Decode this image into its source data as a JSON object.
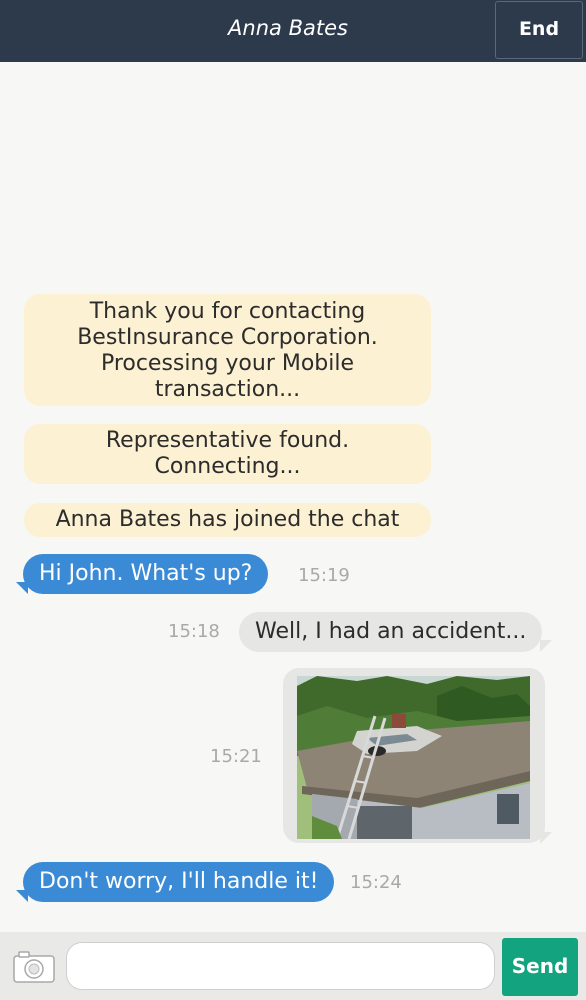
{
  "header": {
    "title": "Anna Bates",
    "end_label": "End"
  },
  "system_messages": [
    "Thank you for contacting BestInsurance Corporation. Processing your Mobile transaction...",
    "Representative found. Connecting...",
    "Anna Bates has joined the chat"
  ],
  "messages": [
    {
      "sender": "agent",
      "text": "Hi John. What's up?",
      "time": "15:19"
    },
    {
      "sender": "user",
      "text": "Well, I had an accident...",
      "time": "15:18"
    },
    {
      "sender": "user",
      "type": "image",
      "image_description": "photo of a car crashed onto a house roof with a ladder",
      "time": "15:21"
    },
    {
      "sender": "agent",
      "text": "Don't worry, I'll handle it!",
      "time": "15:24"
    }
  ],
  "input": {
    "placeholder": "",
    "value": "",
    "send_label": "Send",
    "camera_icon": "camera-icon"
  },
  "colors": {
    "header_bg": "#2c3a4c",
    "agent_bubble": "#3a8ad6",
    "user_bubble": "#e6e6e5",
    "system_bubble": "#fdf1d3",
    "send_button": "#13a37f"
  }
}
